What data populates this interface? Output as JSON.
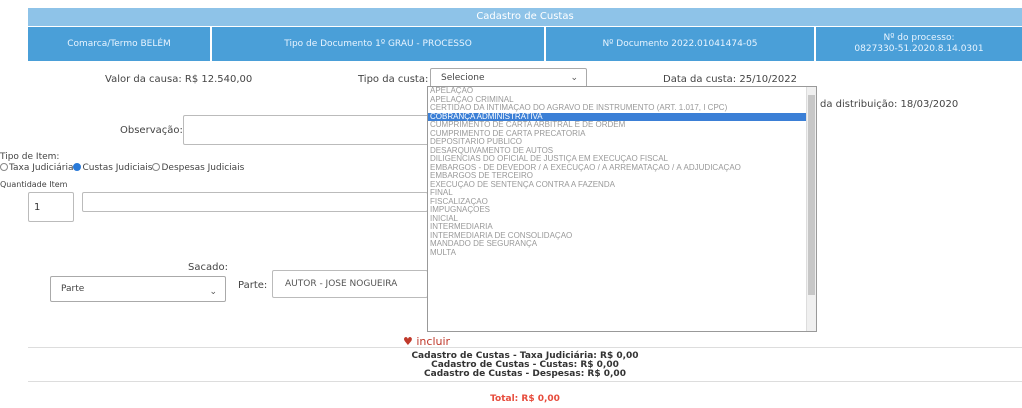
{
  "header": {
    "title": "Cadastro de Custas",
    "comarca": "Comarca/Termo BELÉM",
    "tipo_documento": "Tipo de Documento 1º GRAU - PROCESSO",
    "numero_documento": "Nº Documento 2022.01041474-05",
    "processo_label": "Nº do processo:",
    "processo_numero": "0827330-51.2020.8.14.0301"
  },
  "form": {
    "valor_causa": "Valor da causa: R$ 12.540,00",
    "tipo_custa_label": "Tipo da custa:",
    "tipo_custa_value": "Selecione",
    "data_custa": "Data da custa: 25/10/2022",
    "data_distribuicao": "da distribuição: 18/03/2020",
    "observacao_label": "Observação:",
    "tipo_item_label": "Tipo de Item:",
    "tipo_item_options": [
      "Taxa Judiciária",
      "Custas Judiciais",
      "Despesas Judiciais"
    ],
    "quantidade_label": "Quantidade Item",
    "quantidade_value": "1",
    "sacado_label": "Sacado:",
    "sacado_value": "Parte",
    "parte_label": "Parte:",
    "parte_value": "AUTOR - JOSE NOGUEIRA",
    "incluir_label": "incluir"
  },
  "dropdown": {
    "options": [
      "APELAÇÃO",
      "APELAÇÃO CRIMINAL",
      "CERTIDÃO DA INTIMAÇÃO DO AGRAVO DE INSTRUMENTO (ART. 1.017, I CPC)",
      "COBRANÇA ADMINISTRATIVA",
      "CUMPRIMENTO DE CARTA ARBITRAL E DE ORDEM",
      "CUMPRIMENTO DE CARTA PRECATÓRIA",
      "DEPOSITÁRIO PÚBLICO",
      "DESARQUIVAMENTO DE AUTOS",
      "DILIGÊNCIAS DO OFICIAL DE JUSTIÇA EM EXECUÇÃO FISCAL",
      "EMBARGOS - DE DEVEDOR / À EXECUÇÃO / À ARREMATAÇÃO / À ADJUDICAÇÃO",
      "EMBARGOS DE TERCEIRO",
      "EXECUÇÃO DE SENTENÇA CONTRA A FAZENDA",
      "FINAL",
      "FISCALIZAÇÃO",
      "IMPUGNAÇÕES",
      "INICIAL",
      "INTERMEDIÁRIA",
      "INTERMEDIÁRIA DE CONSOLIDAÇÃO",
      "MANDADO DE SEGURANÇA",
      "MULTA"
    ],
    "selected": "COBRANÇA ADMINISTRATIVA"
  },
  "totals": {
    "taxa": "Cadastro de Custas - Taxa Judiciária: R$ 0,00",
    "custas": "Cadastro de Custas - Custas: R$ 0,00",
    "despesas": "Cadastro de Custas - Despesas: R$ 0,00",
    "total": "Total: R$ 0,00"
  },
  "colors": {
    "header_light": "#8ec3e8",
    "header_dark": "#4a9fd8",
    "selected_option": "#3b7fd6",
    "incluir": "#c0392b",
    "total": "#e74c3c"
  }
}
